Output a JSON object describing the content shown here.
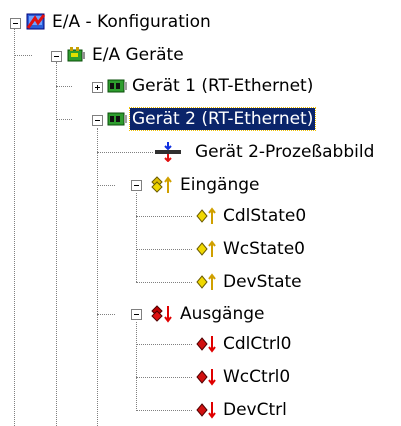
{
  "tree": {
    "root": {
      "label": "E/A - Konfiguration",
      "icon": "io-config-icon"
    },
    "devices": {
      "label": "E/A Geräte",
      "icon": "io-devices-icon"
    },
    "device1": {
      "label": "Gerät 1 (RT-Ethernet)",
      "icon": "network-card-icon",
      "expanded": false
    },
    "device2": {
      "label": "Gerät 2 (RT-Ethernet)",
      "icon": "network-card-icon",
      "expanded": true,
      "selected": true
    },
    "image": {
      "label": "Gerät 2-Prozeßabbild",
      "icon": "process-image-icon"
    },
    "inputs": {
      "label": "Eingänge",
      "icon": "input-group-icon",
      "items": [
        "CdlState0",
        "WcState0",
        "DevState"
      ]
    },
    "outputs": {
      "label": "Ausgänge",
      "icon": "output-group-icon",
      "items": [
        "CdlCtrl0",
        "WcCtrl0",
        "DevCtrl"
      ]
    }
  },
  "colors": {
    "selection": "#0a246a",
    "connector": "#808080",
    "input_arrow": "#d0a000",
    "output_arrow": "#e00000"
  }
}
